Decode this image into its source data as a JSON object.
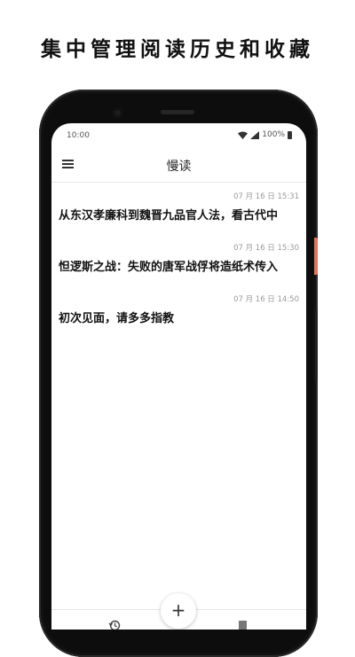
{
  "promo": {
    "title": "集中管理阅读历史和收藏"
  },
  "status_bar": {
    "time": "10:00",
    "battery": "100%"
  },
  "app_bar": {
    "title": "慢读"
  },
  "reading_list": [
    {
      "date": "07 月 16 日 15:31",
      "title": "从东汉孝廉科到魏晋九品官人法，看古代中"
    },
    {
      "date": "07 月 16 日 15:30",
      "title": "怛逻斯之战：失败的唐军战俘将造纸术传入"
    },
    {
      "date": "07 月 16 日 14:50",
      "title": "初次见面，请多多指教"
    }
  ],
  "fab": {
    "label": "+"
  },
  "icons": {
    "menu": "menu-icon",
    "history": "history-icon",
    "bookmark": "bookmark-icon",
    "wifi": "wifi-icon",
    "signal": "signal-icon",
    "battery": "battery-icon"
  },
  "colors": {
    "accent_side_button": "#e0735c",
    "background": "#ffffff",
    "phone": "#0d0d0d"
  }
}
